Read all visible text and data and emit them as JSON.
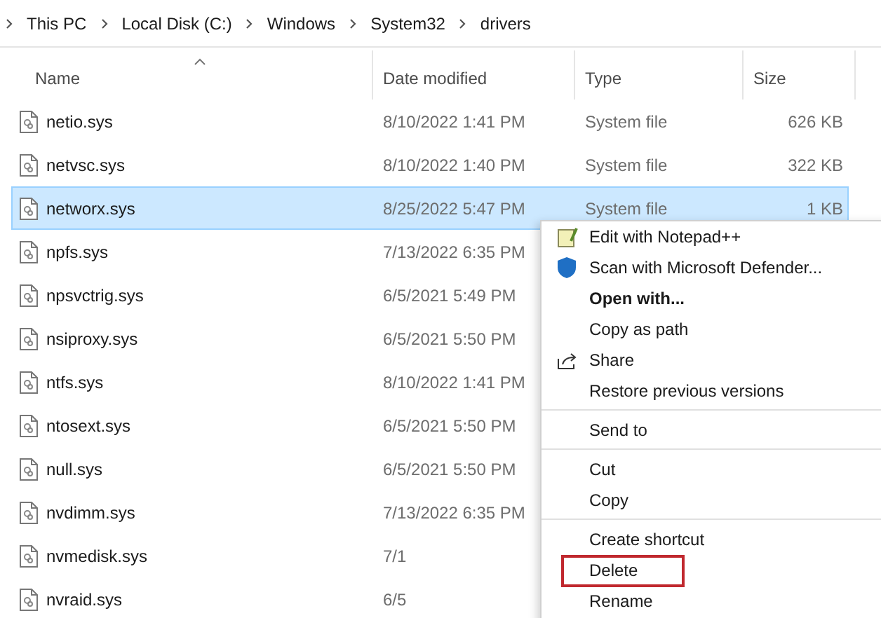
{
  "breadcrumb": [
    "This PC",
    "Local Disk (C:)",
    "Windows",
    "System32",
    "drivers"
  ],
  "columns": [
    {
      "label": "Name",
      "sorted": true
    },
    {
      "label": "Date modified",
      "sorted": false
    },
    {
      "label": "Type",
      "sorted": false
    },
    {
      "label": "Size",
      "sorted": false
    }
  ],
  "rows": [
    {
      "name": "netio.sys",
      "date": "8/10/2022 1:41 PM",
      "type": "System file",
      "size": "626 KB",
      "selected": false
    },
    {
      "name": "netvsc.sys",
      "date": "8/10/2022 1:40 PM",
      "type": "System file",
      "size": "322 KB",
      "selected": false
    },
    {
      "name": "networx.sys",
      "date": "8/25/2022 5:47 PM",
      "type": "System file",
      "size": "1 KB",
      "selected": true
    },
    {
      "name": "npfs.sys",
      "date": "7/13/2022 6:35 PM",
      "selected": false
    },
    {
      "name": "npsvctrig.sys",
      "date": "6/5/2021 5:49 PM",
      "selected": false
    },
    {
      "name": "nsiproxy.sys",
      "date": "6/5/2021 5:50 PM",
      "selected": false
    },
    {
      "name": "ntfs.sys",
      "date": "8/10/2022 1:41 PM",
      "selected": false
    },
    {
      "name": "ntosext.sys",
      "date": "6/5/2021 5:50 PM",
      "selected": false
    },
    {
      "name": "null.sys",
      "date": "6/5/2021 5:50 PM",
      "selected": false
    },
    {
      "name": "nvdimm.sys",
      "date": "7/13/2022 6:35 PM",
      "selected": false
    },
    {
      "name": "nvmedisk.sys",
      "date": "7/1",
      "selected": false
    },
    {
      "name": "nvraid.sys",
      "date": "6/5",
      "selected": false
    }
  ],
  "context_menu": {
    "groups": [
      [
        {
          "label": "Edit with Notepad++",
          "kind": "editor",
          "default": false,
          "highlighted": false
        },
        {
          "label": "Scan with Microsoft Defender...",
          "kind": "scan",
          "default": false,
          "highlighted": false
        },
        {
          "label": "Open with...",
          "kind": "plain",
          "default": true,
          "highlighted": false
        },
        {
          "label": "Copy as path",
          "kind": "plain",
          "default": false,
          "highlighted": false
        },
        {
          "label": "Share",
          "kind": "share",
          "default": false,
          "highlighted": false
        },
        {
          "label": "Restore previous versions",
          "kind": "plain",
          "default": false,
          "highlighted": false
        }
      ],
      [
        {
          "label": "Send to",
          "kind": "plain",
          "default": false,
          "highlighted": false
        }
      ],
      [
        {
          "label": "Cut",
          "kind": "plain",
          "default": false,
          "highlighted": false
        },
        {
          "label": "Copy",
          "kind": "plain",
          "default": false,
          "highlighted": false
        }
      ],
      [
        {
          "label": "Create shortcut",
          "kind": "plain",
          "default": false,
          "highlighted": false
        },
        {
          "label": "Delete",
          "kind": "plain",
          "default": false,
          "highlighted": true
        },
        {
          "label": "Rename",
          "kind": "plain",
          "default": false,
          "highlighted": false
        }
      ]
    ]
  }
}
